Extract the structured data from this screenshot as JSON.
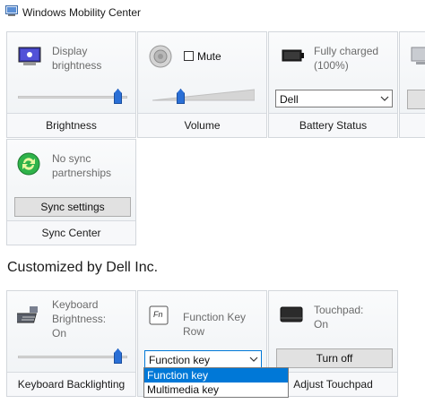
{
  "window": {
    "title": "Windows Mobility Center"
  },
  "tiles": {
    "brightness": {
      "status_line1": "Display",
      "status_line2": "brightness",
      "label": "Brightness",
      "level": 0.95
    },
    "volume": {
      "mute_label": "Mute",
      "label": "Volume",
      "level": 0.27,
      "muted": false
    },
    "battery": {
      "status_line1": "Fully charged",
      "status_line2": "(100%)",
      "plan_value": "Dell",
      "label": "Battery Status"
    },
    "sync": {
      "status_line1": "No sync",
      "status_line2": "partnerships",
      "button_label": "Sync settings",
      "label": "Sync Center"
    }
  },
  "section": {
    "heading": "Customized by Dell Inc."
  },
  "dell_tiles": {
    "keyboard": {
      "status_line1": "Keyboard",
      "status_line2": "Brightness:",
      "status_line3": "On",
      "label": "Keyboard Backlighting",
      "level": 0.95
    },
    "function_key": {
      "status": "Function Key Row",
      "icon_text": "Fn",
      "select_value": "Function key",
      "options": [
        "Function key",
        "Multimedia key"
      ]
    },
    "touchpad": {
      "status_line1": "Touchpad:",
      "status_line2": "On",
      "button_label": "Turn off",
      "label": "Adjust Touchpad"
    }
  },
  "colors": {
    "accent": "#2a6fd6",
    "selection": "#0078d7",
    "tile_border": "#d3d7dc"
  }
}
